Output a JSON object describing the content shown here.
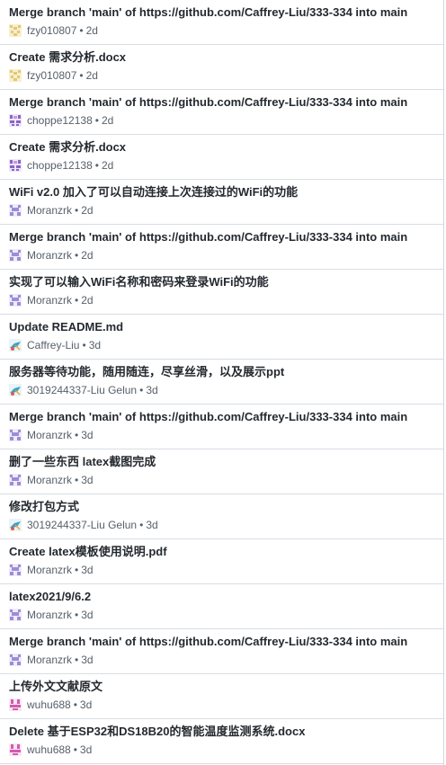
{
  "commits": [
    {
      "title": "Merge branch 'main' of https://github.com/Caffrey-Liu/333-334 into main",
      "author": "fzy010807",
      "time": "2d",
      "avatar": "fzy-avatar"
    },
    {
      "title": "Create 需求分析.docx",
      "author": "fzy010807",
      "time": "2d",
      "avatar": "fzy-avatar"
    },
    {
      "title": "Merge branch 'main' of https://github.com/Caffrey-Liu/333-334 into main",
      "author": "choppe12138",
      "time": "2d",
      "avatar": "choppe-avatar"
    },
    {
      "title": "Create 需求分析.docx",
      "author": "choppe12138",
      "time": "2d",
      "avatar": "choppe-avatar"
    },
    {
      "title": "WiFi v2.0 加入了可以自动连接上次连接过的WiFi的功能",
      "author": "Moranzrk",
      "time": "2d",
      "avatar": "moranzrk-avatar"
    },
    {
      "title": "Merge branch 'main' of https://github.com/Caffrey-Liu/333-334 into main",
      "author": "Moranzrk",
      "time": "2d",
      "avatar": "moranzrk-avatar"
    },
    {
      "title": "实现了可以输入WiFi名称和密码来登录WiFi的功能",
      "author": "Moranzrk",
      "time": "2d",
      "avatar": "moranzrk-avatar"
    },
    {
      "title": "Update README.md",
      "author": "Caffrey-Liu",
      "time": "3d",
      "avatar": "caffrey-avatar"
    },
    {
      "title": "服务器等待功能，随用随连，尽享丝滑，以及展示ppt",
      "author": "3019244337-Liu Gelun",
      "time": "3d",
      "avatar": "caffrey-avatar"
    },
    {
      "title": "Merge branch 'main' of https://github.com/Caffrey-Liu/333-334 into main",
      "author": "Moranzrk",
      "time": "3d",
      "avatar": "moranzrk-avatar"
    },
    {
      "title": "删了一些东西 latex截图完成",
      "author": "Moranzrk",
      "time": "3d",
      "avatar": "moranzrk-avatar"
    },
    {
      "title": "修改打包方式",
      "author": "3019244337-Liu Gelun",
      "time": "3d",
      "avatar": "caffrey-avatar"
    },
    {
      "title": "Create latex模板使用说明.pdf",
      "author": "Moranzrk",
      "time": "3d",
      "avatar": "moranzrk-avatar"
    },
    {
      "title": "latex2021/9/6.2",
      "author": "Moranzrk",
      "time": "3d",
      "avatar": "moranzrk-avatar"
    },
    {
      "title": "Merge branch 'main' of https://github.com/Caffrey-Liu/333-334 into main",
      "author": "Moranzrk",
      "time": "3d",
      "avatar": "moranzrk-avatar"
    },
    {
      "title": "上传外文文献原文",
      "author": "wuhu688",
      "time": "3d",
      "avatar": "wuhu-avatar"
    },
    {
      "title": "Delete 基于ESP32和DS18B20的智能温度监测系统.docx",
      "author": "wuhu688",
      "time": "3d",
      "avatar": "wuhu-avatar"
    }
  ],
  "separator": "•",
  "colors": {
    "fzy-avatar": "#e3c96b",
    "choppe-avatar": "#8a63c9",
    "moranzrk-avatar": "#9d8cd8",
    "caffrey-avatar": "#3c9fc4",
    "wuhu-avatar": "#d25bb0"
  }
}
